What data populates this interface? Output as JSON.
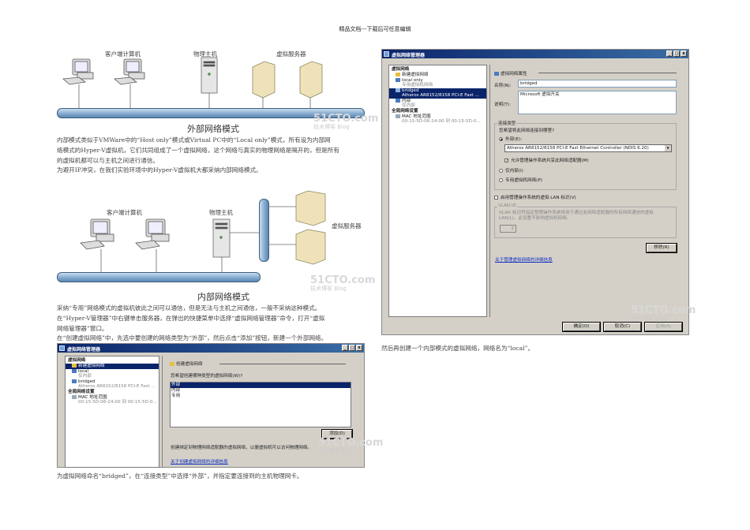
{
  "header": "精品文档---下载后可任意编辑",
  "diagram_external": {
    "label_clients": "客户端计算机",
    "label_host": "物理主机",
    "label_servers": "虚拟服务器",
    "caption": "外部网络模式"
  },
  "watermark": {
    "site": "51CTO.com",
    "sub": "技术博客",
    "blog": "Blog"
  },
  "para1": [
    "内部模式类似于VMWare中的“Host only”模式或Virtual PC中的“Local only”模式，所有设为内部网",
    "络模式的Hyper-V虚拟机，它们共同组成了一个虚拟网络，这个网络与真实的物理网络是隔开的，但是所有",
    "的虚拟机都可以与主机之间进行通信。",
    "为避开IP冲突，在我们实验环境中的Hyper-V虚拟机大都采纳内部网络模式。"
  ],
  "diagram_internal": {
    "label_clients": "客户端计算机",
    "label_host": "物理主机",
    "label_servers": "虚拟服务器",
    "caption": "内部网络模式"
  },
  "para2": [
    "采纳“专用”网络模式的虚拟机彼此之间可以通信，但是无法与主机之间通信，一般不采纳这种模式。",
    "在“Hyper-V管理器”中右键单击服务器，在弹出的快捷菜单中选择“虚拟网络管理器”命令，打开“虚拟",
    "网络管理器”窗口。",
    "在“创建虚拟网络”中，先选中要创建的网络类型为“外部”，然后点击“添加”按钮，新建一个外部网络。"
  ],
  "dialog1": {
    "title": "虚拟网络管理器",
    "sec_networks": "虚拟网络",
    "items": [
      {
        "name": "新建虚拟网络",
        "sub": ""
      },
      {
        "name": "local",
        "sub": "仅内部"
      },
      {
        "name": "bridged",
        "sub": "Atheros AR8152/8158 PCI-E Fast ..."
      }
    ],
    "sec_global": "全局网络设置",
    "mac": {
      "name": "MAC 地址范围",
      "sub": "00-15-5D-06-24-00 到 00-15-5D-0..."
    },
    "panel_title": "创建虚拟网络",
    "question": "您希望创建哪种类型的虚拟网络(W)?",
    "types": [
      "外部",
      "内部",
      "专用"
    ],
    "add_button": "添加(D)",
    "desc": "创建绑定到物理网络适配器的虚拟网络，以便虚拟机可以访问物理网络。",
    "link": "关于创建虚拟网络的详细信息"
  },
  "caption_dialog1": "为虚拟网络命名“bridged”，在“连接类型”中选择“外部”，并指定要连接到的主机物理网卡。",
  "dialog2": {
    "title": "虚拟网络管理器",
    "sec_networks": "虚拟网络",
    "items": [
      {
        "name": "新建虚拟网络",
        "sub": ""
      },
      {
        "name": "local only",
        "sub": "专用虚拟机网络"
      },
      {
        "name": "bridged",
        "sub": "Atheros AR8152/8158 PCI-E Fast ..."
      },
      {
        "name": "内部",
        "sub": "仅内部"
      }
    ],
    "sec_global": "全局网络设置",
    "mac": {
      "name": "MAC 地址范围",
      "sub": "00-15-5D-06-24-00 到 00-15-5D-0..."
    },
    "panel_title": "虚拟网络属性",
    "name_label": "名称(N):",
    "name_value": "bridged",
    "notes_label": "说明(T):",
    "notes_value": "Microsoft 虚拟开关",
    "conn_group": "连接类型",
    "conn_question": "您希望将此网络连接到哪里?",
    "radio_external": "外部(E):",
    "adapter": "Atheros AR8152/8158 PCI-E Fast Ethernet Controller (NDIS 6.20)",
    "allow_share": "允许管理操作系统共享此网络适配器(M)",
    "radio_internal": "仅内部(I)",
    "radio_private": "专用虚拟机网络(P)",
    "vlan_check": "启用管理操作系统的虚拟 LAN 标识(V)",
    "vlan_group": "VLAN ID",
    "vlan_desc": "VLAN 标识符指定管理操作系统将用于通过此网络适配器的所有网络通信的虚拟 LAN(L)。此设置不影响虚拟机网络。",
    "vlan_value": "2",
    "remove_button": "移除(R)",
    "link": "关于管理虚拟网络的详细信息",
    "ok": "确定(O)",
    "cancel": "取消(C)",
    "apply": "应用(A)"
  },
  "caption_dialog2": "然后再创建一个内部模式的虚拟网络，网络名为“local”。"
}
